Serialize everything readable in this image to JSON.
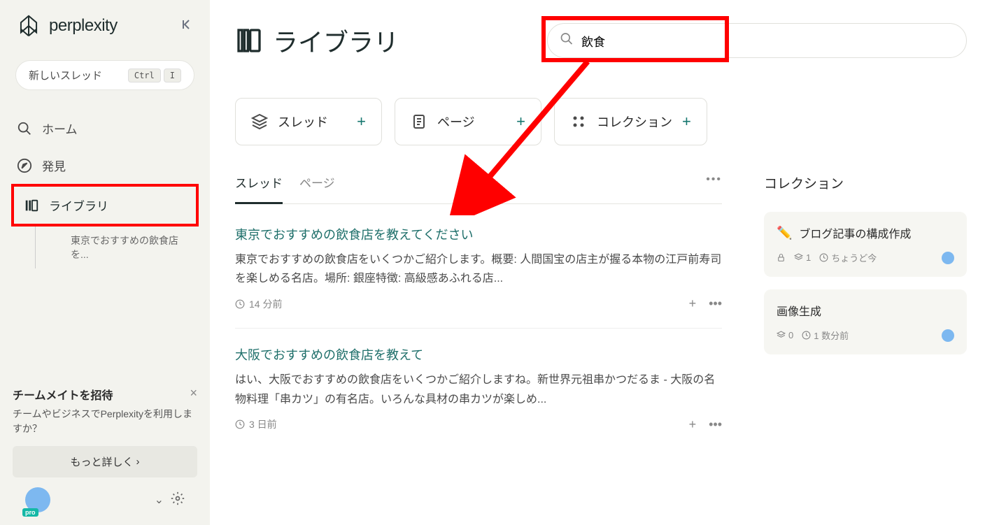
{
  "brand": "perplexity",
  "sidebar": {
    "new_thread": "新しいスレッド",
    "kbd1": "Ctrl",
    "kbd2": "I",
    "nav": {
      "home": "ホーム",
      "discover": "発見",
      "library": "ライブラリ"
    },
    "sub_item": "東京でおすすめの飲食店を...",
    "invite": {
      "title": "チームメイトを招待",
      "desc": "チームやビジネスでPerplexityを利用しますか？",
      "learn_more": "もっと詳しく"
    },
    "pro_badge": "pro"
  },
  "header": {
    "title": "ライブラリ",
    "search_value": "飲食"
  },
  "categories": [
    {
      "label": "スレッド",
      "icon": "layers"
    },
    {
      "label": "ページ",
      "icon": "page"
    },
    {
      "label": "コレクション",
      "icon": "grid"
    }
  ],
  "tabs": {
    "threads": "スレッド",
    "pages": "ページ"
  },
  "threads": [
    {
      "title": "東京でおすすめの飲食店を教えてください",
      "desc": "東京でおすすめの飲食店をいくつかご紹介します。概要: 人間国宝の店主が握る本物の江戸前寿司を楽しめる名店。場所: 銀座特徴: 高級感あふれる店...",
      "time": "14 分前"
    },
    {
      "title": "大阪でおすすめの飲食店を教えて",
      "desc": "はい、大阪でおすすめの飲食店をいくつかご紹介しますね。新世界元祖串かつだるま - 大阪の名物料理「串カツ」の有名店。いろんな具材の串カツが楽しめ...",
      "time": "3 日前"
    }
  ],
  "collections_heading": "コレクション",
  "collections": [
    {
      "emoji": "✏️",
      "title": "ブログ記事の構成作成",
      "count": "1",
      "time": "ちょうど今",
      "lock": true
    },
    {
      "title": "画像生成",
      "count": "0",
      "time": "1 数分前",
      "lock": false
    }
  ]
}
